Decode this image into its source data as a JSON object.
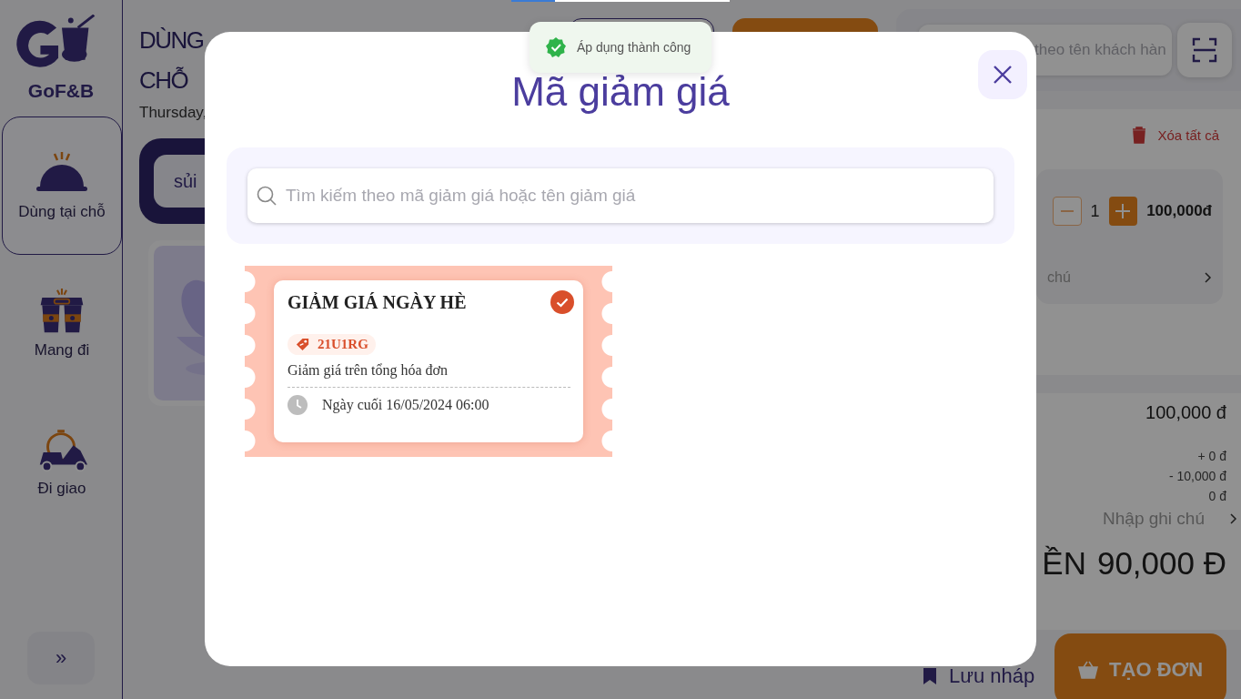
{
  "loading_bar": {
    "level": 0.2
  },
  "sidebar": {
    "logo": "GoF&B",
    "items": [
      {
        "label": "Dùng tại chỗ",
        "kind": "dine-in",
        "selected": true
      },
      {
        "label": "Mang đi",
        "kind": "takeaway",
        "selected": false
      },
      {
        "label": "Đi giao",
        "kind": "delivery",
        "selected": false
      }
    ],
    "expand_button": "»"
  },
  "header": {
    "title_lines": [
      "DÙNG",
      "CHỖ"
    ],
    "date": "Thursday,",
    "category_chip": "sủi"
  },
  "right_panel": {
    "search_placeholder": "theo tên khách hàn",
    "clear_all": "Xóa tất cả",
    "cart_item": {
      "quantity": "1",
      "price": "100,000đ",
      "note": "chú"
    },
    "summary": {
      "subtotal": "100,000 đ",
      "lines": [
        "+ 0 đ",
        "- 10,000 đ",
        "0 đ"
      ],
      "note_placeholder": "Nhập ghi chú",
      "total_label": "ỀN",
      "total": "90,000 Đ"
    },
    "draft_button": "Lưu nháp",
    "create_button": "TẠO ĐƠN"
  },
  "modal": {
    "title": "Mã giảm giá",
    "search_placeholder": "Tìm kiếm theo mã giảm giá hoặc tên giảm giá",
    "vouchers": [
      {
        "title": "GIẢM GIÁ NGÀY HÈ",
        "code": "21U1RG",
        "description": "Giảm giá trên tổng hóa đơn",
        "expiry": "Ngày cuối 16/05/2024 06:00",
        "selected": true
      }
    ]
  },
  "toast": {
    "text": "Áp dụng thành công"
  }
}
